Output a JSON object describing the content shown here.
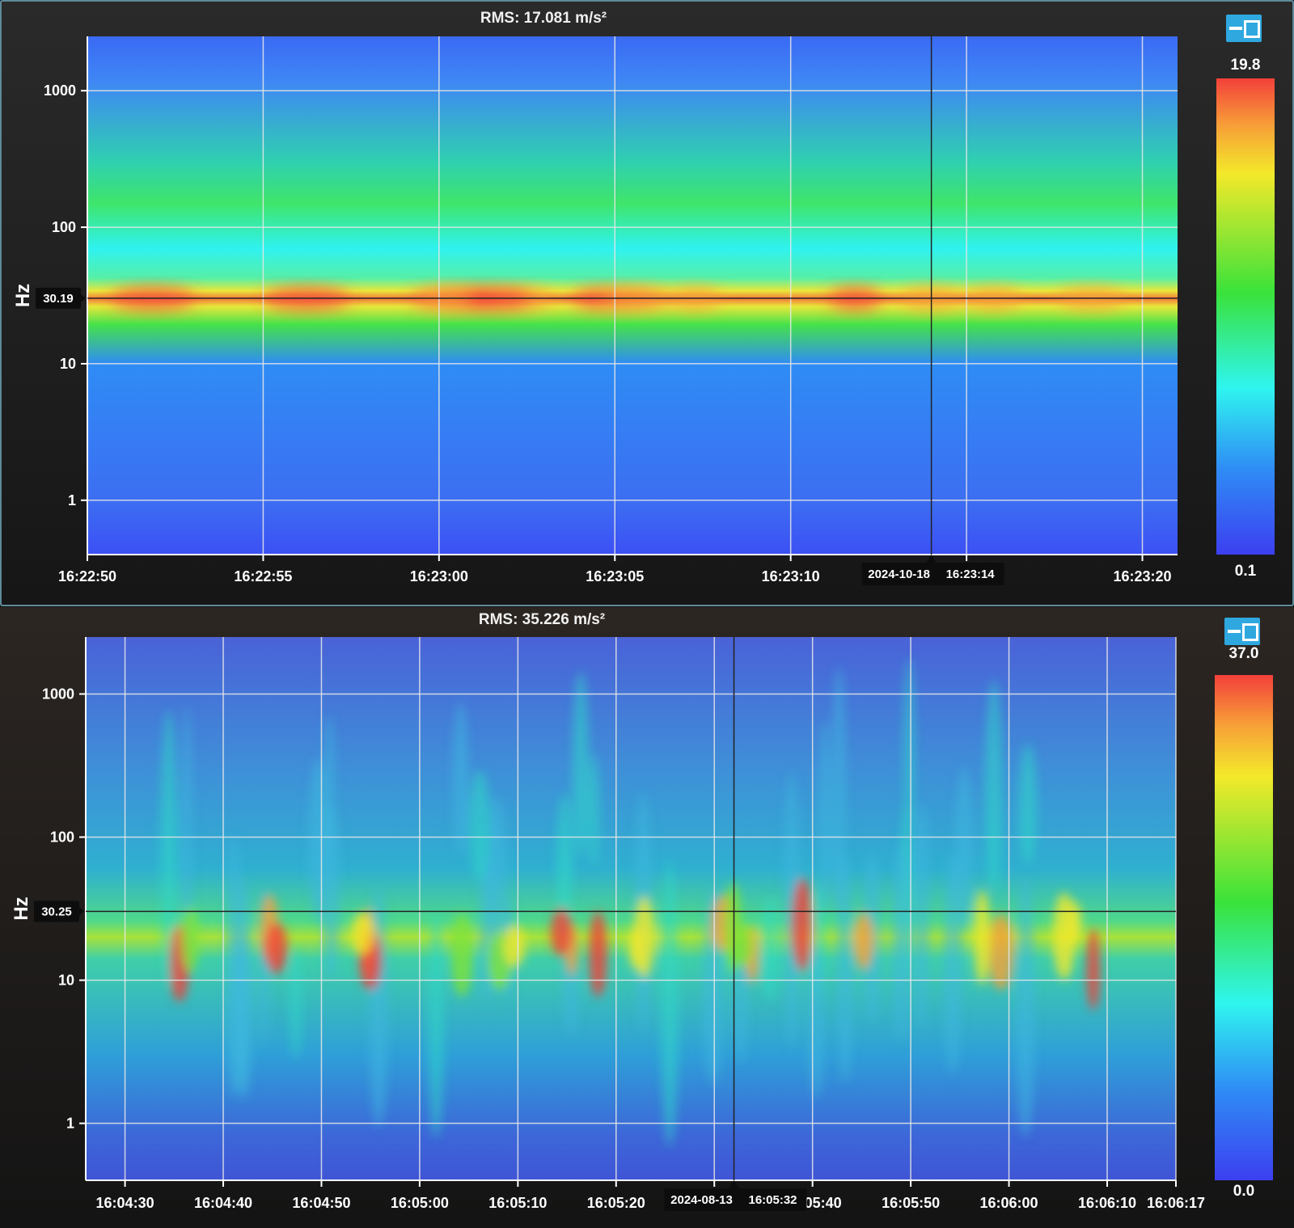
{
  "chart_data": [
    {
      "type": "heatmap",
      "title": "RMS: 17.081 m/s²",
      "ylabel": "Hz",
      "yscale": "log",
      "ylim": [
        0.4,
        2500
      ],
      "yticks": [
        "1",
        "10",
        "100",
        "1000"
      ],
      "xlim": [
        "16:22:50",
        "16:23:21"
      ],
      "xticks": [
        "16:22:50",
        "16:22:55",
        "16:23:00",
        "16:23:05",
        "16:23:10",
        "16:23:15",
        "16:23:20"
      ],
      "colorbar": {
        "max": "19.8",
        "min": "0.1"
      },
      "cursor": {
        "date": "2024-10-18",
        "time": "16:23:14",
        "y_value": "30.19"
      },
      "dominant_band_hz": 30
    },
    {
      "type": "heatmap",
      "title": "RMS: 35.226 m/s²",
      "ylabel": "Hz",
      "yscale": "log",
      "ylim": [
        0.4,
        2500
      ],
      "yticks": [
        "1",
        "10",
        "100",
        "1000"
      ],
      "xlim": [
        "16:04:26",
        "16:06:17"
      ],
      "xticks": [
        "16:04:30",
        "16:04:40",
        "16:04:50",
        "16:05:00",
        "16:05:10",
        "16:05:20",
        "16:05:30",
        "16:05:40",
        "16:05:50",
        "16:06:00",
        "16:06:10",
        "16:06:17"
      ],
      "colorbar": {
        "max": "37.0",
        "min": "0.0"
      },
      "cursor": {
        "date": "2024-08-13",
        "time": "16:05:32",
        "y_value": "30.25"
      },
      "dominant_band_hz": 20
    }
  ],
  "icons": {
    "restore": "window-restore-icon"
  }
}
